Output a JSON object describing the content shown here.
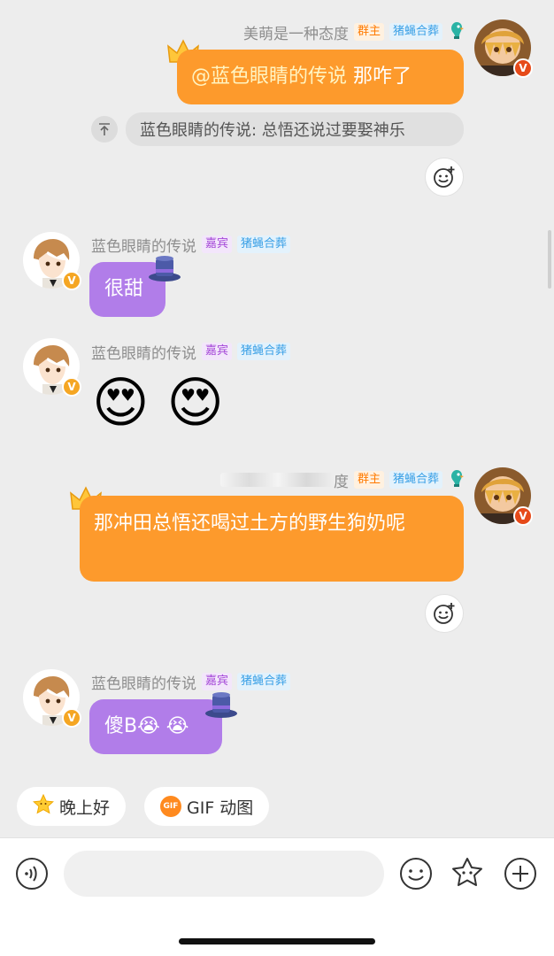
{
  "messages": [
    {
      "sender": "美萌是一种态度",
      "tags": {
        "role": "群主",
        "group": "猪蝇合葬"
      },
      "mention": "@蓝色眼睛的传说",
      "text": "那咋了",
      "quote": "蓝色眼睛的传说: 总悟还说过要娶神乐"
    },
    {
      "sender": "蓝色眼睛的传说",
      "tags": {
        "role": "嘉宾",
        "group": "猪蝇合葬"
      },
      "text": "很甜"
    },
    {
      "sender": "蓝色眼睛的传说",
      "tags": {
        "role": "嘉宾",
        "group": "猪蝇合葬"
      },
      "text": "😍 😍"
    },
    {
      "sender_visible": "度",
      "tags": {
        "role": "群主",
        "group": "猪蝇合葬"
      },
      "text": "那冲田总悟还喝过土方的野生狗奶呢"
    },
    {
      "sender": "蓝色眼睛的传说",
      "tags": {
        "role": "嘉宾",
        "group": "猪蝇合葬"
      },
      "text": "傻B😭 😭"
    }
  ],
  "quick_replies": [
    {
      "label": "晚上好",
      "icon": "star-face-icon"
    },
    {
      "label": "GIF 动图",
      "icon": "gif-icon",
      "icon_text": "GIF"
    }
  ],
  "input": {
    "placeholder": ""
  },
  "toolbar": {
    "voice_icon": "voice-icon",
    "emoji_icon": "emoji-icon",
    "sticker_icon": "sticker-icon",
    "plus_icon": "plus-icon"
  },
  "badge_label": "V",
  "colors": {
    "background": "#ededed",
    "orange_bubble": "#fd9a2c",
    "purple_bubble": "#b17de9",
    "owner_tag": "#ff7a00",
    "guest_tag": "#a64ad8",
    "group_tag": "#3aa0e6"
  }
}
